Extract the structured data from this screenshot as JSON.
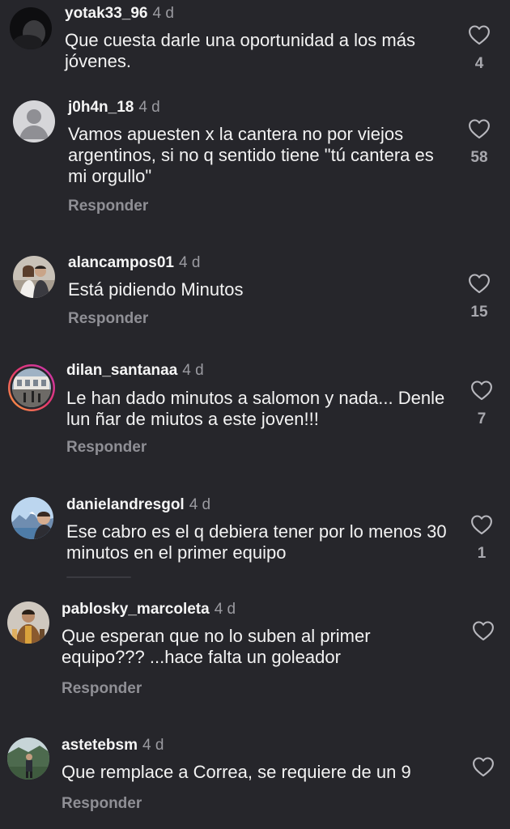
{
  "comments": [
    {
      "username": "yotak33_96",
      "time": "4 d",
      "text": "Que cuesta darle una oportunidad a los más jóvenes.",
      "likes": "4",
      "reply": ""
    },
    {
      "username": "j0h4n_18",
      "time": "4 d",
      "text": "Vamos apuesten x la cantera no por viejos argentinos, si no q sentido tiene \"tú cantera es mi orgullo\"",
      "likes": "58",
      "reply": "Responder"
    },
    {
      "username": "alancampos01",
      "time": "4 d",
      "text": "Está pidiendo Minutos",
      "likes": "15",
      "reply": "Responder"
    },
    {
      "username": "dilan_santanaa",
      "time": "4 d",
      "text": "Le han dado minutos a salomon y nada... Denle lun ñar de miutos a este joven!!!",
      "likes": "7",
      "reply": "Responder"
    },
    {
      "username": "danielandresgol",
      "time": "4 d",
      "text": "Ese cabro es el q debiera tener por lo menos 30 minutos en el primer equipo",
      "likes": "1",
      "reply": ""
    },
    {
      "username": "pablosky_marcoleta",
      "time": "4 d",
      "text": "Que esperan que no lo suben al primer equipo??? ...hace falta un goleador",
      "likes": "",
      "reply": "Responder"
    },
    {
      "username": "astetebsm",
      "time": "4 d",
      "text": "Que remplace a Correa, se requiere de un 9",
      "likes": "",
      "reply": "Responder"
    }
  ],
  "icons": {
    "like": "heart-outline-icon",
    "default_avatar": "person-silhouette-icon"
  },
  "colors": {
    "background": "#26262b",
    "story_ring_start": "#f9a23a",
    "story_ring_end": "#c536b4"
  }
}
